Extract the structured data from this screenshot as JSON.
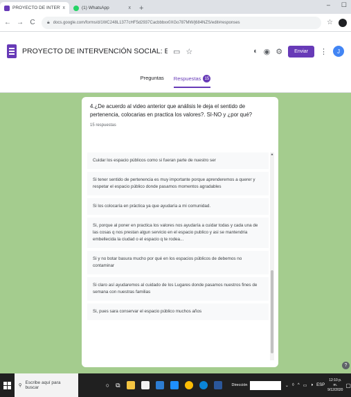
{
  "browser": {
    "tabs": [
      {
        "title": "PROYECTO DE INTERVENCIÓN S",
        "close": "x",
        "favicon_color": "#673ab7",
        "active": true
      },
      {
        "title": "(1) WhatsApp",
        "close": "x",
        "favicon_color": "#25d366",
        "active": false
      }
    ],
    "new_tab": "+",
    "window_controls": {
      "minimize": "–",
      "maximize": "☐"
    },
    "url": "docs.google.com/forms/d/1WC248L1377cHF5d2937Cacbbbxx0XGo787MW/j684NZS/edit#responses"
  },
  "form": {
    "title": "PROYECTO DE INTERVENCIÓN SOCIAL: ESTRATEGIAS PARAEL MEJORAM",
    "send_label": "Enviar",
    "avatar_letter": "J",
    "tabs": {
      "questions": "Preguntas",
      "responses": "Respuestas",
      "responses_count": "15"
    }
  },
  "question": {
    "text": "4.¿De acuerdo al video anterior que análisis le deja el sentido de pertenencia, colocarias en practica los valores?. SI-NO y ¿por qué?",
    "count": "15 respuestas",
    "responses": [
      "Cuidar los espacio públicos como si fueran parte de nuestro ser",
      "Si tener sentido de pertenencia es muy importante porque aprenderemos a querer y respetar el espacio público donde pasamos momentos agradables",
      "Si los colocaría en práctica ya que ayudaría a mi comunidad.",
      "Si, porque al poner en practica los valores nos ayudaría a cuidar todas y cada una de las cosas q nos prestan algun servicio en el espacio publico y asi se mantendria embellecida la ciudad o el espacio q te rodea...",
      "Si y no botar basura mucho por qué en los espacios públicos de debemos no contaminar",
      "Si claro así ayudaremos al cuidado de los Lugares donde pasamos nuestros fines de semana con nuestras familias",
      "Si, pues sara conservar el espacio público muchos años"
    ]
  },
  "colors": {
    "accent": "#673ab7",
    "background": "#a4cc8e",
    "taskbar": "#202020"
  },
  "taskbar": {
    "search_placeholder": "Escribe aquí para buscar",
    "direction_label": "Dirección",
    "time": "12:10 p. m.",
    "date": "9/12/2020"
  }
}
